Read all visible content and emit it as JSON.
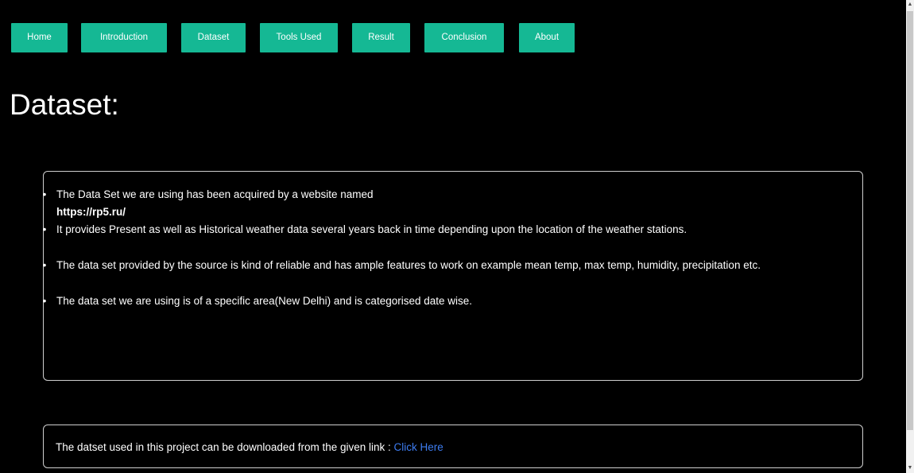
{
  "nav": {
    "items": [
      {
        "label": "Home"
      },
      {
        "label": "Introduction"
      },
      {
        "label": "Dataset"
      },
      {
        "label": "Tools Used"
      },
      {
        "label": "Result"
      },
      {
        "label": "Conclusion"
      },
      {
        "label": "About"
      }
    ]
  },
  "page_title": "Dataset:",
  "dataset_panel": {
    "bullets": [
      {
        "text": "The Data Set we are using has been acquired by a website named",
        "url": "https://rp5.ru/"
      },
      {
        "text": "It provides Present as well as Historical weather data several years back in time depending upon the location of the weather stations."
      },
      {
        "text": "The data set provided by the source is kind of reliable and has ample features to work on example mean temp, max temp, humidity, precipitation etc."
      },
      {
        "text": "The data set we are using is of a specific area(New Delhi) and is categorised date wise."
      }
    ]
  },
  "download_panel": {
    "text": "The datset used in this project can be downloaded from the given link : ",
    "link_label": "Click Here"
  },
  "colors": {
    "background": "#000000",
    "nav_button": "#15b894",
    "link": "#3d7cf0",
    "panel_border": "#cfcfcf"
  },
  "icons": {
    "bullet": "•",
    "scroll_up": "chevron-up-icon",
    "scroll_down": "chevron-down-icon"
  }
}
